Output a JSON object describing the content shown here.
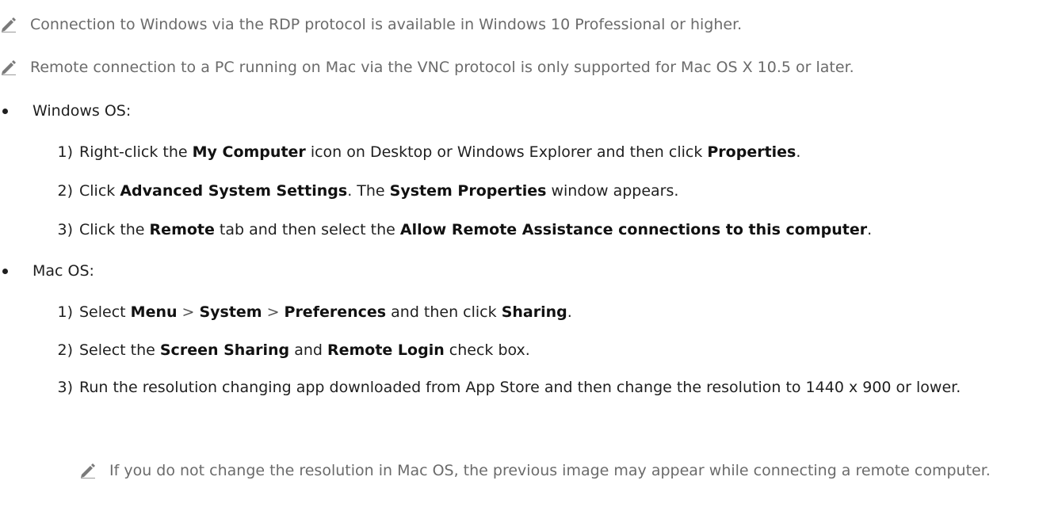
{
  "notes": {
    "rdp": "Connection to Windows via the RDP protocol is available in Windows 10 Professional or higher.",
    "vnc": "Remote connection to a PC running on Mac via the VNC protocol is only supported for Mac OS X 10.5 or later.",
    "resolution": "If you do not change the resolution in Mac OS, the previous image may appear while connecting a remote computer."
  },
  "windows": {
    "heading": "Windows OS:",
    "step1": {
      "num": "1)",
      "t1": "Right-click the ",
      "b1": "My Computer",
      "t2": " icon on Desktop or Windows Explorer and then click ",
      "b2": "Properties",
      "t3": "."
    },
    "step2": {
      "num": "2)",
      "t1": "Click ",
      "b1": "Advanced System Settings",
      "t2": ". The ",
      "b2": "System Properties",
      "t3": " window appears."
    },
    "step3": {
      "num": "3)",
      "t1": "Click the ",
      "b1": "Remote",
      "t2": " tab and then select the ",
      "b2": "Allow Remote Assistance connections to this computer",
      "t3": "."
    }
  },
  "mac": {
    "heading": "Mac OS:",
    "step1": {
      "num": "1)",
      "t1": "Select ",
      "b1": "Menu",
      "sep1": ">",
      "b2": "System",
      "sep2": ">",
      "b3": "Preferences",
      "t2": " and then click ",
      "b4": "Sharing",
      "t3": "."
    },
    "step2": {
      "num": "2)",
      "t1": "Select the ",
      "b1": "Screen Sharing",
      "t2": " and ",
      "b2": "Remote Login",
      "t3": " check box."
    },
    "step3": {
      "num": "3)",
      "text": "Run the resolution changing app downloaded from App Store and then change the resolution to 1440 x 900 or lower."
    }
  }
}
